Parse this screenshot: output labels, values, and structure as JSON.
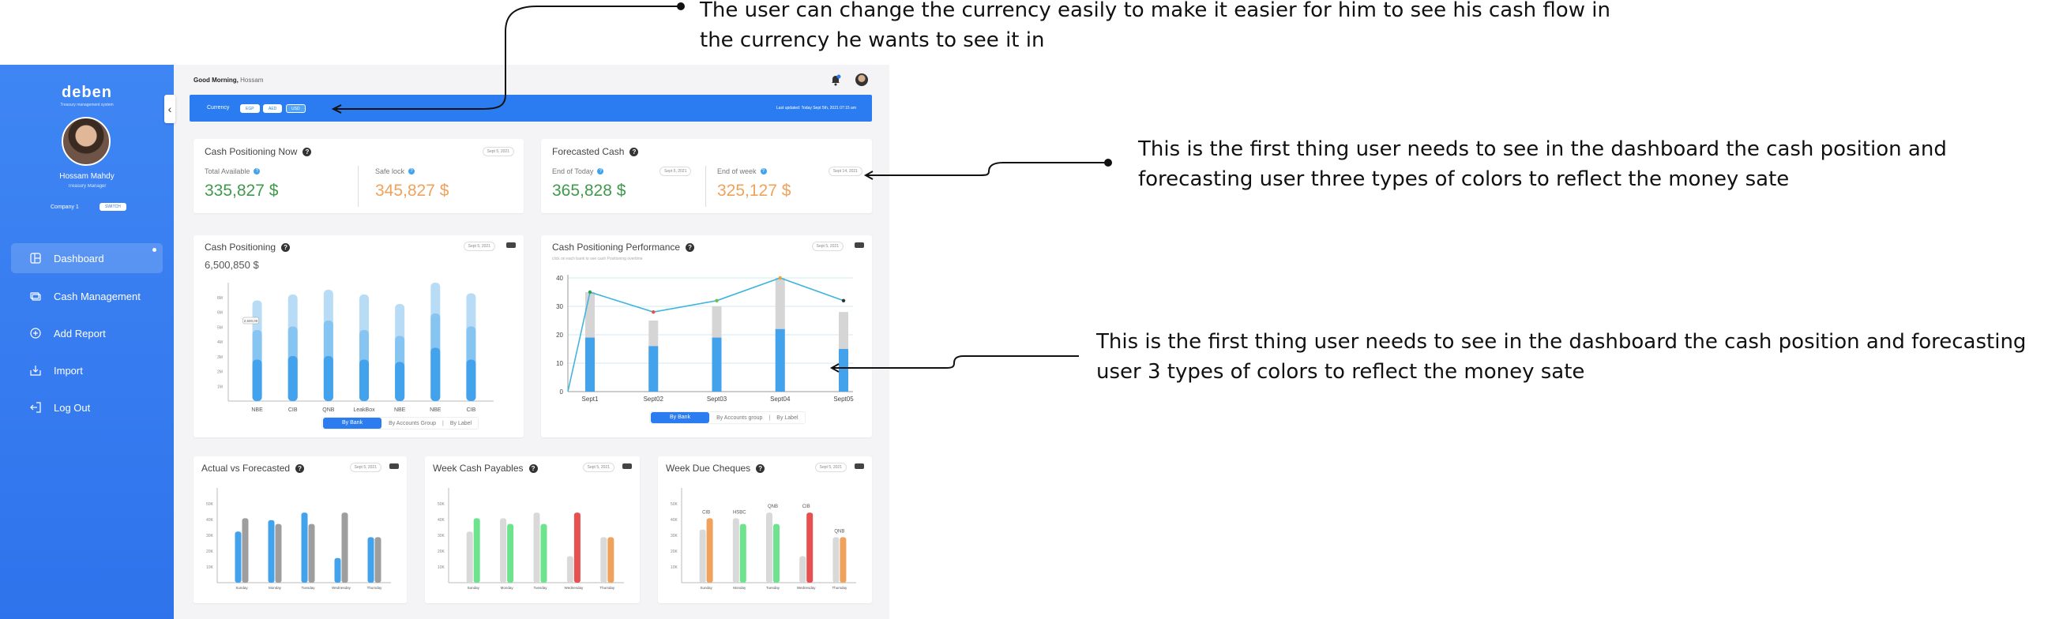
{
  "sidebar": {
    "logo": "deben",
    "logo_tagline": "Treasury management system",
    "user_name": "Hossam Mahdy",
    "user_role": "Treasury Manager",
    "company": "Company 1",
    "switch_label": "SWITCH",
    "items": [
      {
        "label": "Dashboard",
        "icon": "dashboard-icon",
        "active": true
      },
      {
        "label": "Cash Management",
        "icon": "cash-icon"
      },
      {
        "label": "Add Report",
        "icon": "add-circle-icon"
      },
      {
        "label": "Import",
        "icon": "import-icon"
      },
      {
        "label": "Log Out",
        "icon": "logout-icon"
      }
    ]
  },
  "header": {
    "greeting": "Good Morning,",
    "greeting_name": "Hossam"
  },
  "currency_bar": {
    "label": "Currency",
    "options": [
      "EGP",
      "AED",
      "USD"
    ],
    "selected": "USD",
    "last_updated": "Last updated: Today    Sept 5th, 2021    07:15 am"
  },
  "cash_now": {
    "title": "Cash Positioning Now",
    "date": "Sept 5, 2021",
    "total_label": "Total Available",
    "total_value": "335,827 $",
    "safe_label": "Safe lock",
    "safe_value": "345,827 $"
  },
  "forecast": {
    "title": "Forecasted Cash",
    "end_today_label": "End of Today",
    "end_today_date": "Sept 5, 2021",
    "end_today_value": "365,828 $",
    "end_week_label": "End of week",
    "end_week_date": "Sept 14, 2021",
    "end_week_value": "325,127 $"
  },
  "cash_positioning": {
    "title": "Cash Positioning",
    "date": "Sept 5, 2021",
    "total": "6,500,850 $",
    "tooltip": "2,500,00",
    "tabs": [
      "By Bank",
      "By  Accounts Group",
      "By Label"
    ],
    "tab_separator": "|"
  },
  "performance": {
    "title": "Cash Positioning Performance",
    "date": "Sept 5, 2021",
    "subtitle": "click on each bank to see cash Positioning overtime",
    "tabs": [
      "By Bank",
      "By  Accounts group",
      "By Label"
    ],
    "tab_separator": "|"
  },
  "small_cards": [
    {
      "title": "Actual vs Forecasted",
      "date": "Sept 5, 2021"
    },
    {
      "title": "Week Cash Payables",
      "date": "Sept 5, 2021"
    },
    {
      "title": "Week Due Cheques",
      "date": "Sept 5, 2021"
    }
  ],
  "annotations": {
    "currency": "The user can change the currency easily to make it easier for him to see his cash flow in the currency he wants to see it in",
    "cash_position": "This is the first thing user needs to see in the dashboard the cash position and forecasting user three types of colors to reflect the money sate",
    "performance": "This is the first thing user needs to see in the dashboard the cash position and forecasting user 3 types of colors to reflect the money sate"
  },
  "colors": {
    "sidebar": "#3f86f4",
    "accent": "#2a7cf0",
    "positive": "#3f9a4b",
    "warning": "#f0a25c",
    "bar_light": "#b9dcf6",
    "bar_mid": "#86c4f1",
    "bar_dark": "#43a2ec",
    "payables_green": "#6ee38e",
    "alert_red": "#e85050"
  },
  "chart_data": [
    {
      "type": "bar",
      "title": "Cash Positioning",
      "categories": [
        "NBE",
        "CIB",
        "QNB",
        "LeakBox",
        "NBE",
        "NBE",
        "CIB"
      ],
      "ylim": [
        0,
        10
      ],
      "y_ticks": [
        "1M",
        "2M",
        "3M",
        "4M",
        "5M",
        "6M",
        "8M"
      ],
      "series": [
        {
          "values": [
            8.5,
            9.0,
            9.4,
            9.0,
            8.2,
            10.0,
            9.1
          ]
        },
        {
          "values": [
            6.0,
            6.3,
            6.8,
            6.0,
            5.5,
            7.4,
            6.3
          ]
        },
        {
          "values": [
            3.5,
            3.8,
            3.8,
            3.5,
            3.3,
            4.5,
            3.5
          ]
        }
      ]
    },
    {
      "type": "line",
      "title": "Cash Positioning Performance",
      "categories": [
        "Sept1",
        "Sept02",
        "Sept03",
        "Sept04",
        "Sept05"
      ],
      "ylim": [
        0,
        40
      ],
      "y_ticks": [
        0,
        10,
        20,
        30,
        40
      ],
      "line_values": [
        35,
        28,
        32,
        40,
        32
      ],
      "bar_values": [
        35,
        25,
        30,
        40,
        28
      ],
      "bar_base_values": [
        19,
        16,
        19,
        22,
        15
      ]
    },
    {
      "type": "bar",
      "title": "Actual vs Forecasted",
      "categories": [
        "Sunday",
        "Monday",
        "Tuesday",
        "Wednesday",
        "Thursday"
      ],
      "y_ticks": [
        "10K",
        "20K",
        "30K",
        "40K",
        "50K"
      ],
      "ylim": [
        0,
        50
      ],
      "series": [
        {
          "values": [
            27,
            33,
            37,
            13,
            24
          ]
        },
        {
          "values": [
            34,
            31,
            31,
            37,
            24
          ]
        }
      ]
    },
    {
      "type": "bar",
      "title": "Week Cash Payables",
      "categories": [
        "Sunday",
        "Monday",
        "Tuesday",
        "Wednesday",
        "Thursday"
      ],
      "y_ticks": [
        "10K",
        "20K",
        "30K",
        "40K",
        "50K"
      ],
      "ylim": [
        0,
        50
      ],
      "series": [
        {
          "values": [
            27,
            34,
            37,
            14,
            24
          ]
        },
        {
          "values": [
            34,
            31,
            31,
            37,
            24
          ]
        }
      ]
    },
    {
      "type": "bar",
      "title": "Week Due Cheques",
      "categories": [
        "Sunday",
        "Monday",
        "Tuesday",
        "Wednesday",
        "Thursday"
      ],
      "y_ticks": [
        "10K",
        "20K",
        "30K",
        "40K",
        "50K"
      ],
      "ylim": [
        0,
        50
      ],
      "bar_labels": [
        "CIB",
        "HSBC",
        "QNB",
        "CIB",
        "QNB"
      ],
      "series": [
        {
          "values": [
            28,
            34,
            37,
            14,
            24
          ]
        },
        {
          "values": [
            34,
            31,
            31,
            37,
            24
          ]
        }
      ]
    }
  ]
}
